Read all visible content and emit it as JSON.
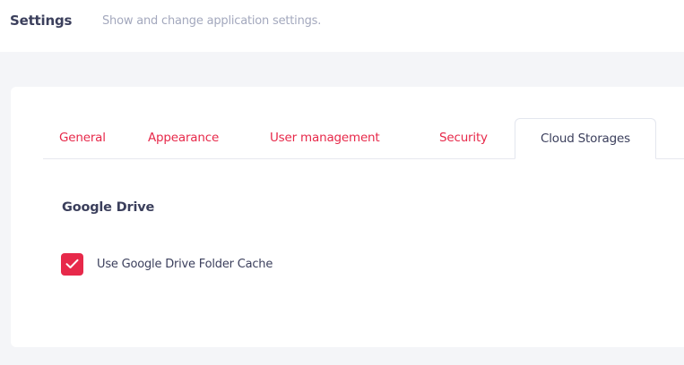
{
  "header": {
    "title": "Settings",
    "subtitle": "Show and change application settings."
  },
  "tabs": [
    {
      "label": "General",
      "active": false
    },
    {
      "label": "Appearance",
      "active": false
    },
    {
      "label": "User management",
      "active": false
    },
    {
      "label": "Security",
      "active": false
    },
    {
      "label": "Cloud Storages",
      "active": true
    }
  ],
  "section": {
    "title": "Google Drive",
    "checkbox": {
      "label": "Use Google Drive Folder Cache",
      "checked": true,
      "icon": "check-icon"
    }
  },
  "colors": {
    "accent": "#e7294a",
    "text": "#3b3f5c",
    "muted": "#a3a8bd",
    "background": "#f4f5f8"
  }
}
